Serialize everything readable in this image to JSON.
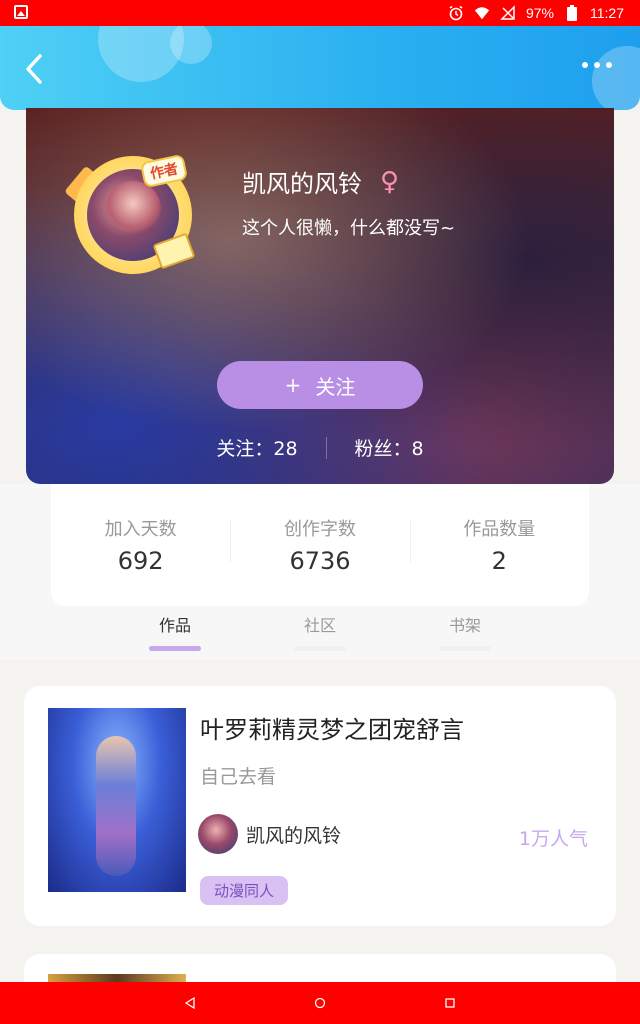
{
  "status_bar": {
    "battery": "97%",
    "time": "11:27"
  },
  "header": {
    "back_icon": "chevron-left-icon",
    "more_icon": "more-dots-icon"
  },
  "profile": {
    "avatar_badge": "作者",
    "username": "凯风的风铃",
    "gender_symbol": "♀",
    "bio": "这个人很懒，什么都没写~",
    "follow_button": {
      "icon": "+",
      "label": "关注"
    },
    "following": "关注：28",
    "followers": "粉丝：8"
  },
  "stats": [
    {
      "label": "加入天数",
      "value": "692"
    },
    {
      "label": "创作字数",
      "value": "6736"
    },
    {
      "label": "作品数量",
      "value": "2"
    }
  ],
  "tabs": [
    {
      "label": "作品",
      "active": true
    },
    {
      "label": "社区",
      "active": false
    },
    {
      "label": "书架",
      "active": false
    }
  ],
  "works": [
    {
      "title": "叶罗莉精灵梦之团宠舒言",
      "subtitle": "自己去看",
      "author": "凯风的风铃",
      "popularity": "1万人气",
      "tag": "动漫同人"
    }
  ],
  "colors": {
    "accent": "#c7a8ef",
    "header": "#2ab0f0",
    "system_bar": "#ff0000"
  }
}
